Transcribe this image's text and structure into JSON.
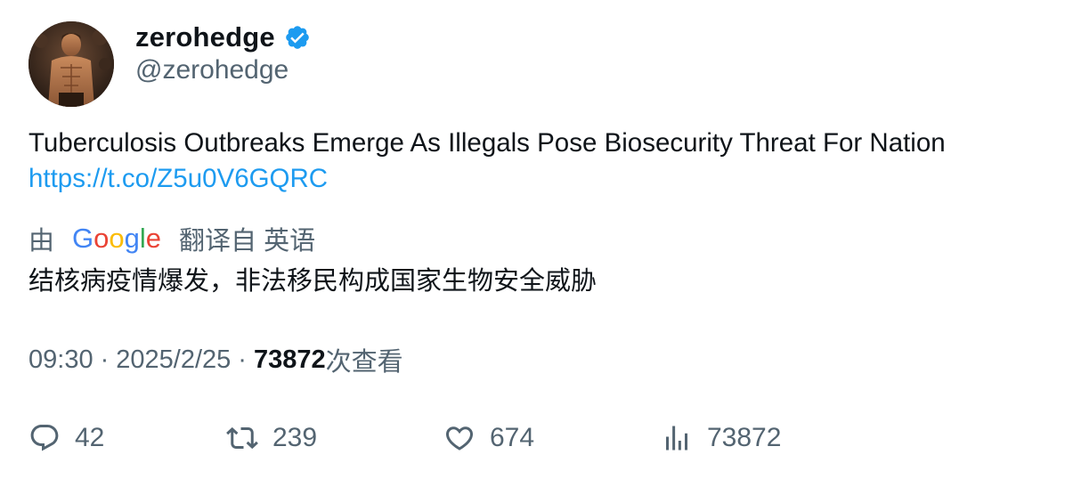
{
  "author": {
    "display_name": "zerohedge",
    "handle": "@zerohedge",
    "verified_icon": "verified-badge-icon",
    "verified_color": "#1d9bf0"
  },
  "tweet": {
    "text": "Tuberculosis Outbreaks Emerge As Illegals Pose Biosecurity Threat For Nation",
    "link": "https://t.co/Z5u0V6GQRC"
  },
  "translation": {
    "by_label": "由",
    "provider": "Google",
    "translated_from_label": "翻译自 英语",
    "translated_text": "结核病疫情爆发，非法移民构成国家生物安全威胁"
  },
  "meta": {
    "time": "09:30",
    "date": "2025/2/25",
    "separator": "·",
    "views_count": "73872",
    "views_label": "次查看"
  },
  "actions": {
    "replies": "42",
    "reposts": "239",
    "likes": "674",
    "views": "73872"
  },
  "colors": {
    "accent": "#1d9bf0",
    "secondary_text": "#536471",
    "primary_text": "#0f1419"
  }
}
